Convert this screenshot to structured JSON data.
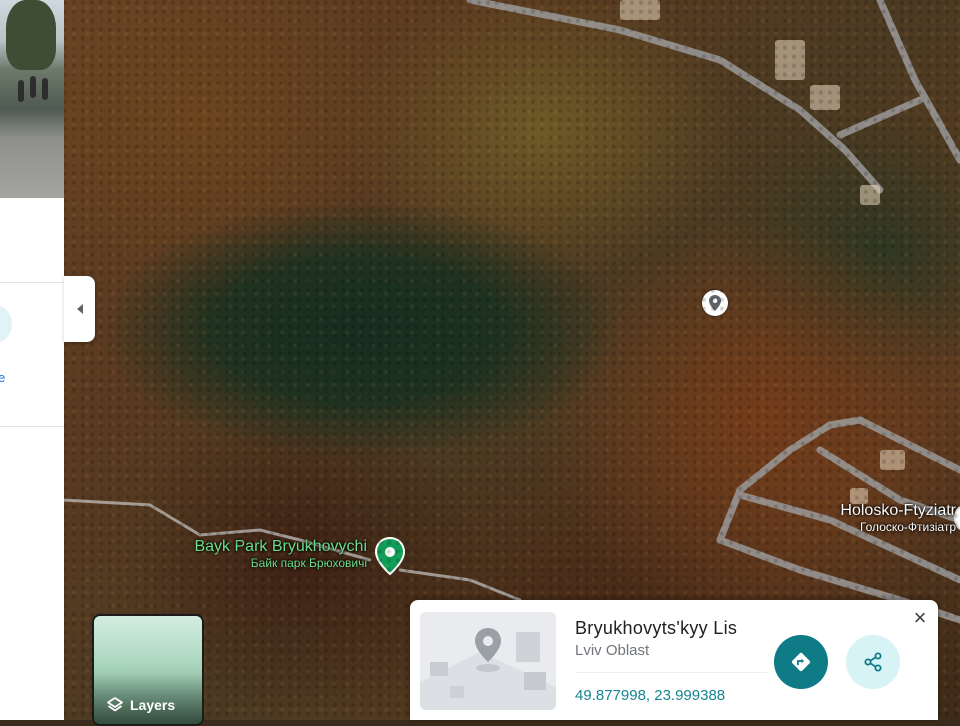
{
  "map": {
    "place_labels": [
      {
        "name": "Bayk Park Bryukhovychi",
        "local_name": "Байк парк Брюховичі"
      },
      {
        "name": "Holosko-Ftyziatr",
        "local_name": "Голоско-Фтизіатр"
      }
    ],
    "dropped_pin_icon": "location-pin-icon",
    "park_pin_icon": "green-place-pin-icon"
  },
  "side_panel": {
    "collapse_icon": "chevron-left-icon",
    "partial_label": "e"
  },
  "layers": {
    "label": "Layers",
    "icon": "layers-icon"
  },
  "info_card": {
    "title": "Bryukhovyts'kyy Lis",
    "subtitle": "Lviv Oblast",
    "coordinates": "49.877998, 23.999388",
    "close_icon": "close-icon",
    "directions_icon": "directions-icon",
    "share_icon": "share-icon"
  },
  "colors": {
    "accent": "#0f7b87",
    "share_bg": "#d8f3f5",
    "park_label": "#6ce08c",
    "coords_text": "#15848f"
  }
}
